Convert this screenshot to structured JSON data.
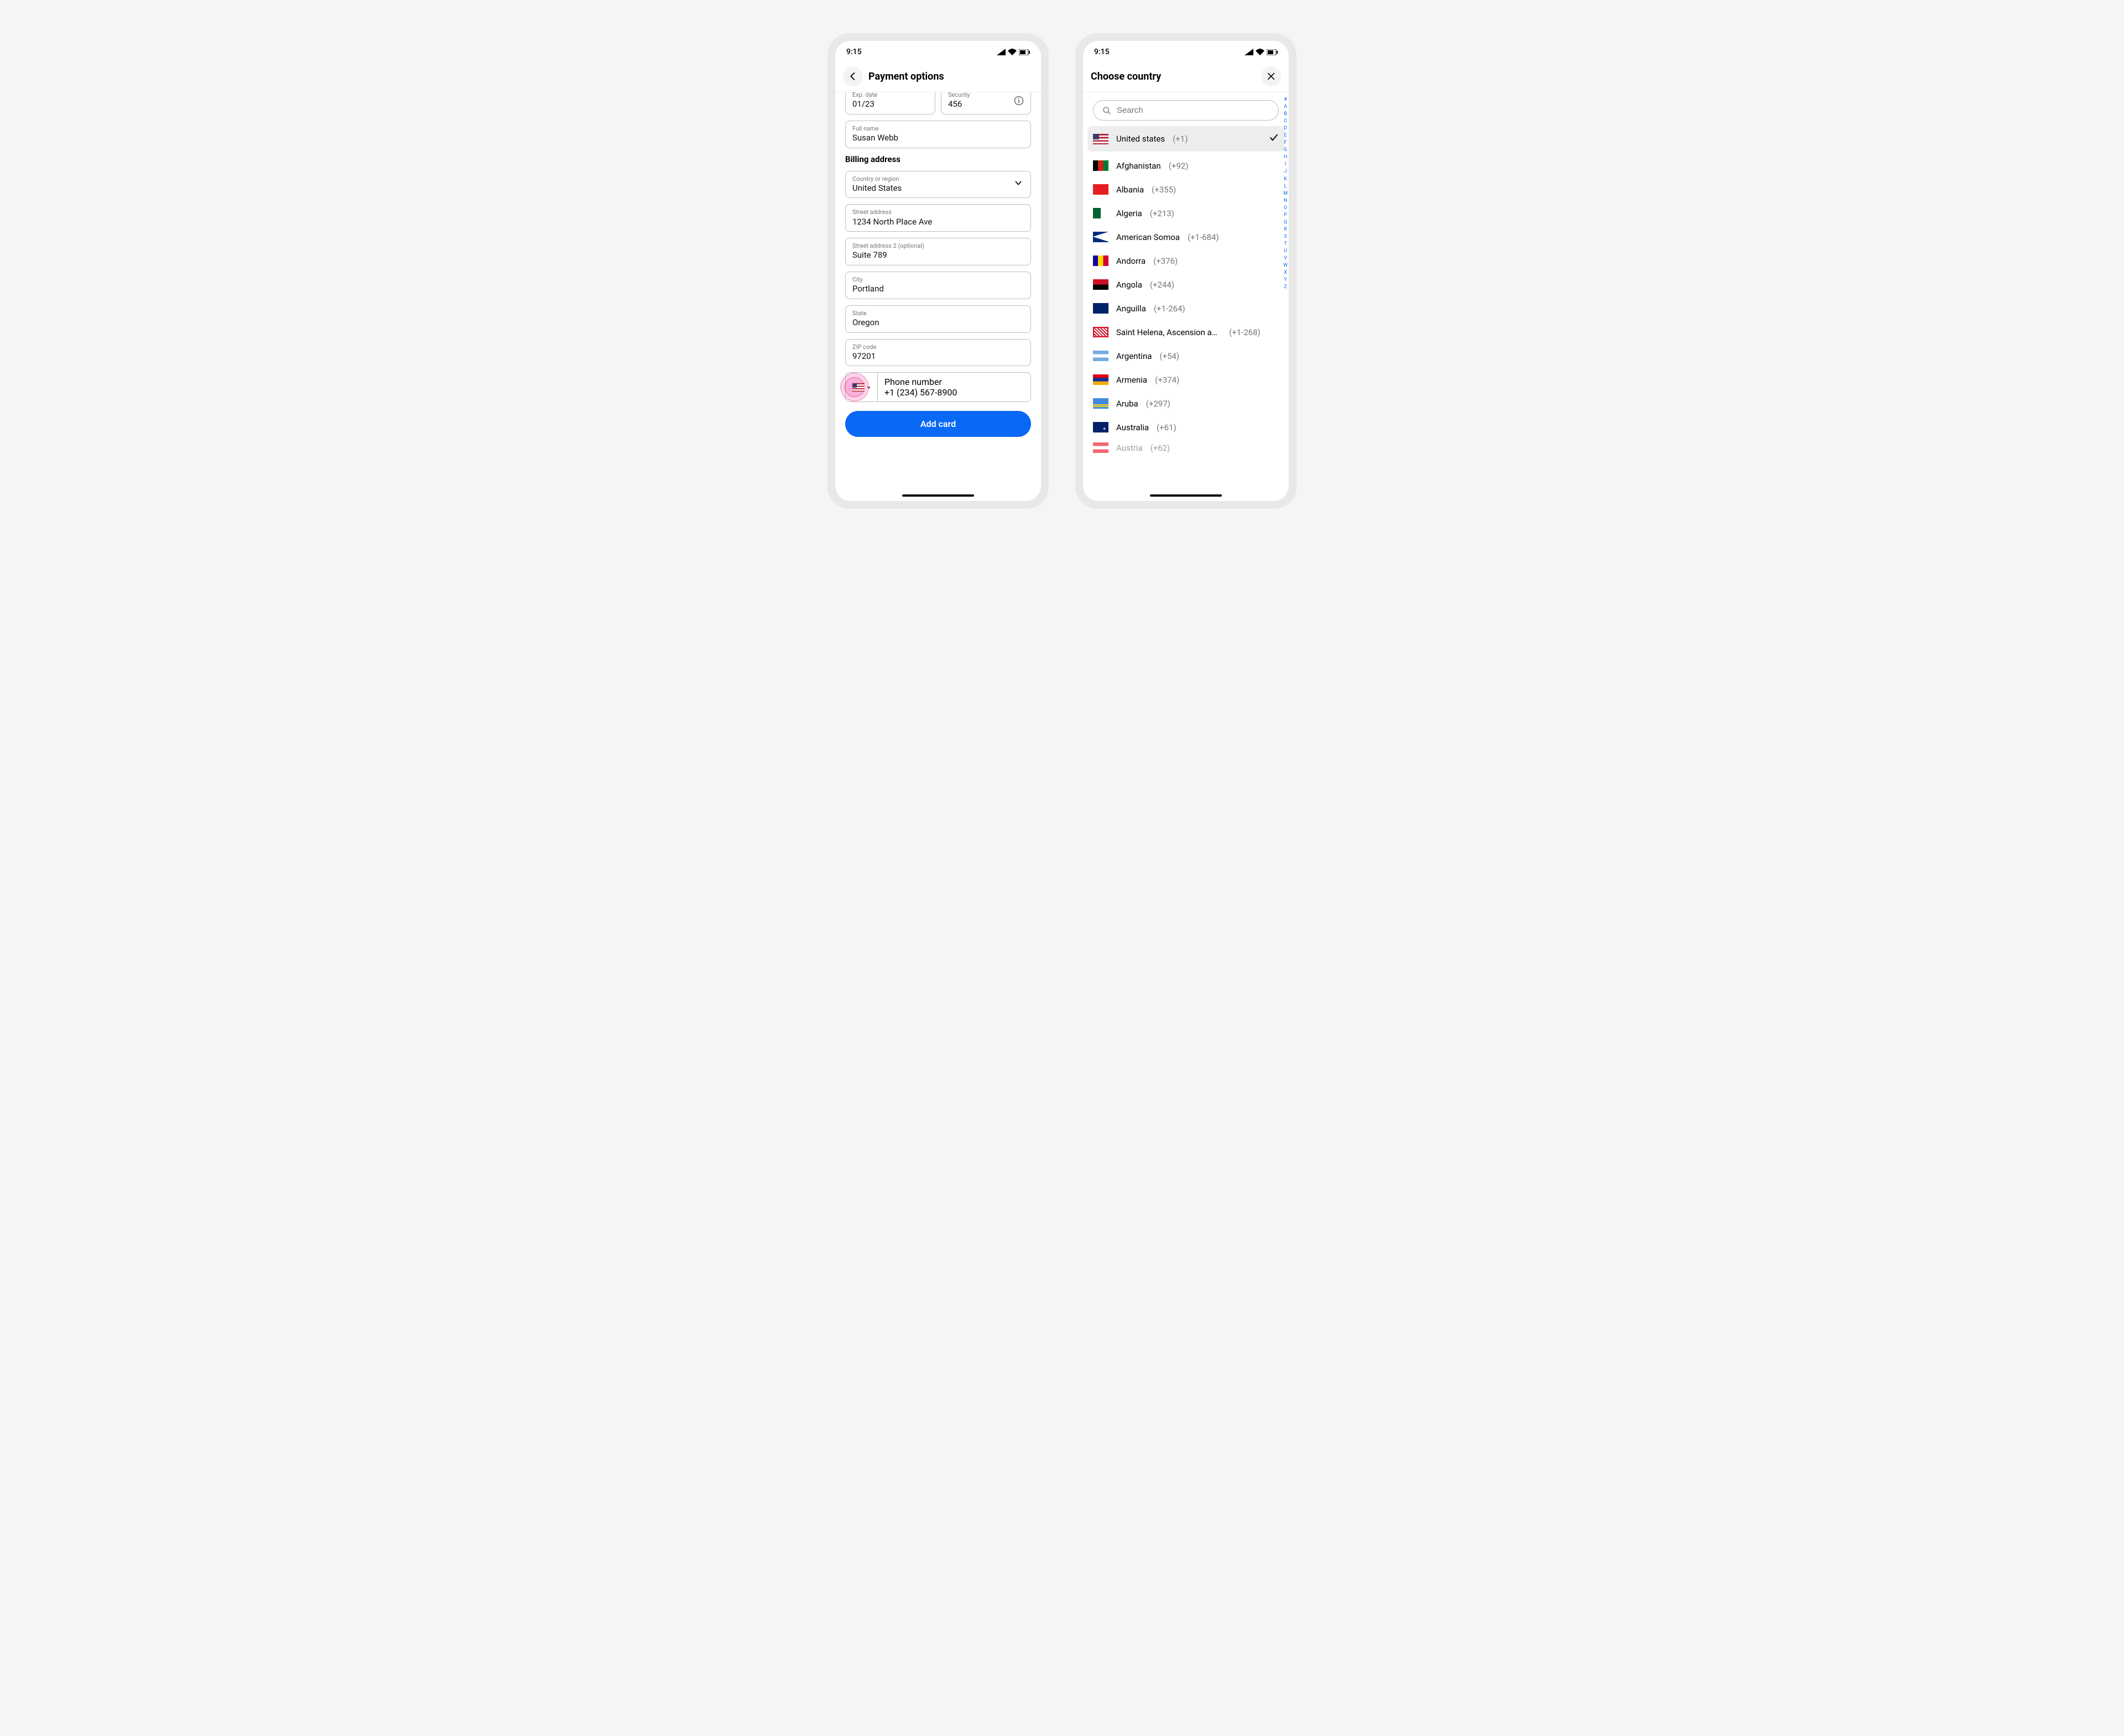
{
  "status": {
    "time": "9:15"
  },
  "screen1": {
    "title": "Payment options",
    "exp_label": "Exp. date",
    "exp_value": "01/23",
    "sec_label": "Security",
    "sec_value": "456",
    "name_label": "Full name",
    "name_value": "Susan Webb",
    "billing_header": "Billing address",
    "country_label": "Country or region",
    "country_value": "United States",
    "street_label": "Street address",
    "street_value": "1234 North Place Ave",
    "street2_label": "Street address 2 (optional)",
    "street2_value": "Suite 789",
    "city_label": "City",
    "city_value": "Portland",
    "state_label": "State",
    "state_value": "Oregon",
    "zip_label": "ZIP code",
    "zip_value": "97201",
    "phone_label": "Phone number",
    "phone_value": "+1 (234) 567-8900",
    "cta": "Add card"
  },
  "screen2": {
    "title": "Choose country",
    "search_placeholder": "Search",
    "countries": [
      {
        "flag": "us",
        "name": "United states",
        "code": "(+1)",
        "selected": true
      },
      {
        "flag": "af",
        "name": "Afghanistan",
        "code": "(+92)"
      },
      {
        "flag": "al",
        "name": "Albania",
        "code": "(+355)"
      },
      {
        "flag": "dz",
        "name": "Algeria",
        "code": "(+213)"
      },
      {
        "flag": "as",
        "name": "American Somoa",
        "code": "(+1-684)"
      },
      {
        "flag": "ad",
        "name": "Andorra",
        "code": "(+376)"
      },
      {
        "flag": "ao",
        "name": "Angola",
        "code": "(+244)"
      },
      {
        "flag": "ai",
        "name": "Anguilla",
        "code": "(+1-264)"
      },
      {
        "flag": "sh",
        "name": "Saint Helena, Ascension and Tris...",
        "code": "(+1-268)"
      },
      {
        "flag": "ar",
        "name": "Argentina",
        "code": "(+54)"
      },
      {
        "flag": "am",
        "name": "Armenia",
        "code": "(+374)"
      },
      {
        "flag": "aw",
        "name": "Aruba",
        "code": "(+297)"
      },
      {
        "flag": "au",
        "name": "Australia",
        "code": "(+61)"
      }
    ],
    "partial": {
      "flag": "at",
      "name": "Austria",
      "code": "(+62)"
    },
    "index": [
      "#",
      "A",
      "B",
      "C",
      "D",
      "E",
      "F",
      "G",
      "H",
      "I",
      "J",
      "K",
      "L",
      "M",
      "N",
      "O",
      "P",
      "Q",
      "R",
      "S",
      "T",
      "U",
      "V",
      "W",
      "X",
      "Y",
      "Z"
    ]
  }
}
